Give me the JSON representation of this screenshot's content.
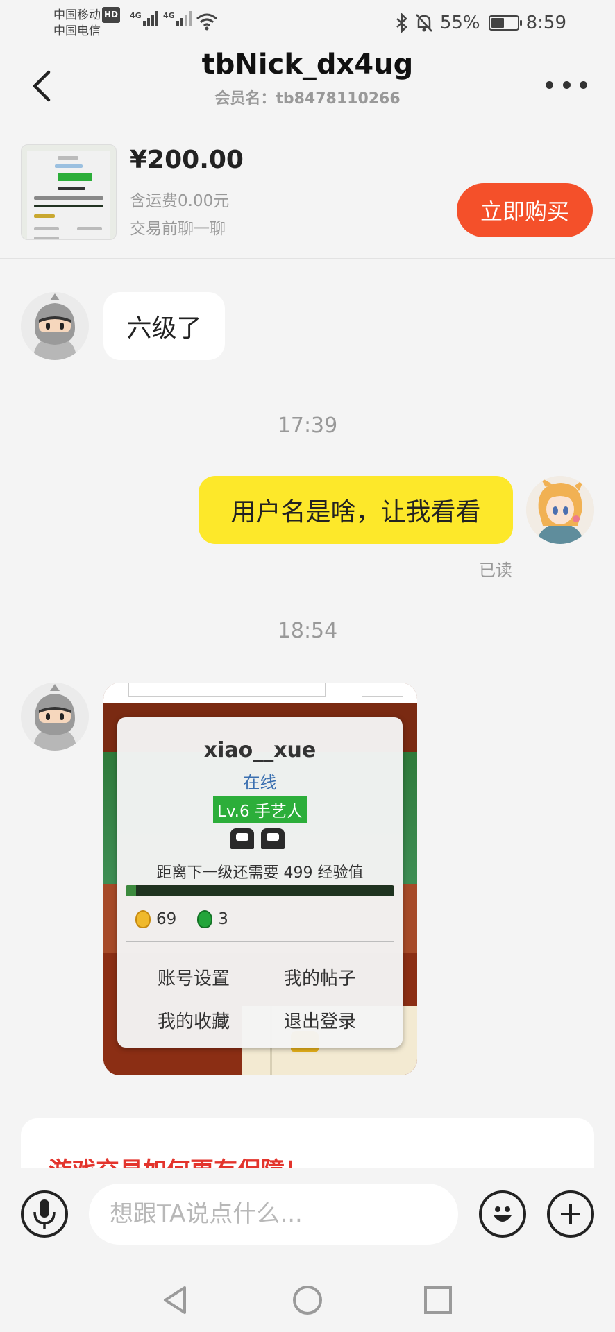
{
  "status_bar": {
    "carrier_1": "中国移动",
    "hd_label": "HD",
    "carrier_2": "中国电信",
    "network_1": "4G",
    "network_2": "4G",
    "battery_percent": "55%",
    "battery_level": 0.55,
    "time": "8:59"
  },
  "header": {
    "title": "tbNick_dx4ug",
    "subtitle": "会员名：tb8478110266"
  },
  "product": {
    "price": "¥200.00",
    "shipping": "含运费0.00元",
    "chat_hint": "交易前聊一聊",
    "buy_label": "立即购买"
  },
  "messages": [
    {
      "from": "seller",
      "text": "六级了"
    },
    {
      "time": "17:39"
    },
    {
      "from": "me",
      "text": "用户名是啥，让我看看",
      "status": "已读"
    },
    {
      "time": "18:54"
    },
    {
      "from": "seller",
      "image": true
    }
  ],
  "screenshot_popup": {
    "username": "xiao__xue",
    "online": "在线",
    "level": "Lv.6 手艺人",
    "exp_text": "距离下一级还需要 499 经验值",
    "gold": "69",
    "gems": "3",
    "menu": [
      "账号设置",
      "我的帖子",
      "我的收藏",
      "退出登录"
    ]
  },
  "protect_card": {
    "title": "游戏交易如何更有保障！"
  },
  "input_bar": {
    "placeholder": "想跟TA说点什么..."
  },
  "icons": {
    "back": "chevron-left-icon",
    "more": "more-dots-icon",
    "voice": "microphone-icon",
    "emoji": "emoji-icon",
    "add": "plus-icon",
    "nav_back": "triangle-back-icon",
    "nav_home": "circle-home-icon",
    "nav_recent": "square-recent-icon"
  },
  "colors": {
    "accent": "#f4502a",
    "my_bubble": "#fde82a",
    "level_badge": "#2cae3a",
    "warning_title": "#e3342c"
  }
}
